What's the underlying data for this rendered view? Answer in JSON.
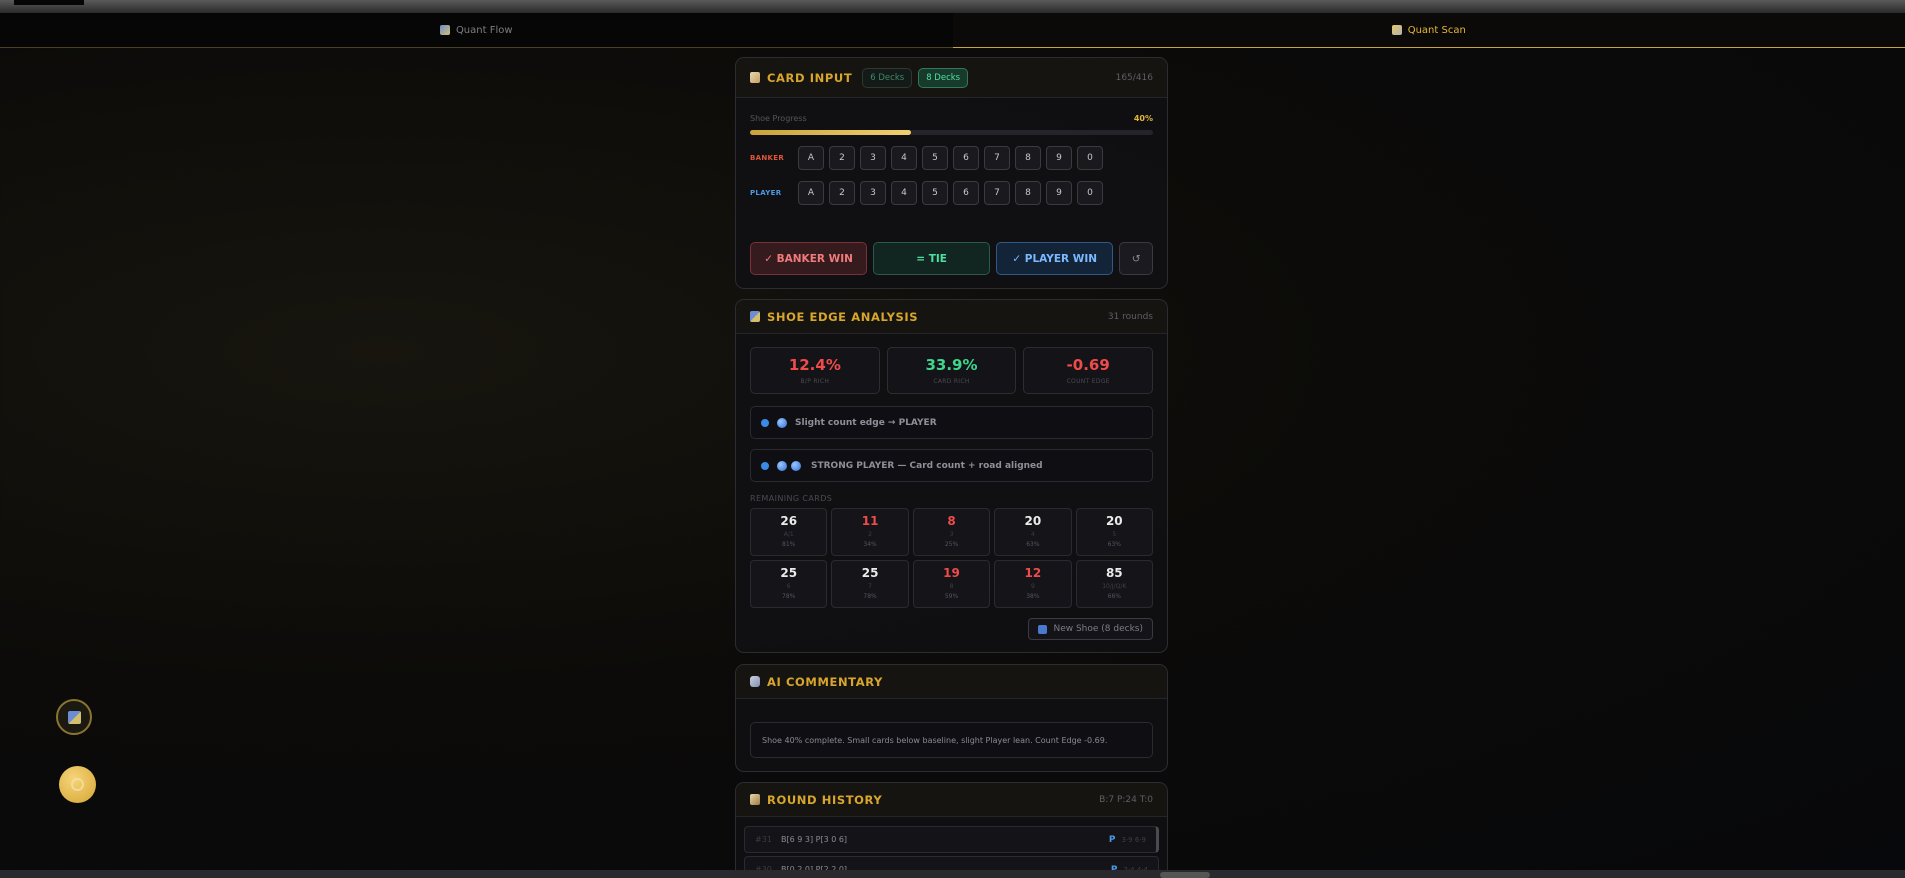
{
  "tabs": [
    {
      "label": "Quant Flow",
      "icon": "chart-icon"
    },
    {
      "label": "Quant Scan",
      "icon": "scan-icon"
    }
  ],
  "card_input": {
    "title": "CARD INPUT",
    "deck_options": [
      "6 Decks",
      "8 Decks"
    ],
    "selected_deck": "8 Decks",
    "counter": "165/416",
    "progress_label": "Shoe Progress",
    "progress_pct": "40%",
    "progress_value": 0.4,
    "banker_label": "BANKER",
    "player_label": "PLAYER",
    "keys": [
      "A",
      "2",
      "3",
      "4",
      "5",
      "6",
      "7",
      "8",
      "9",
      "0"
    ],
    "banker_win": "✓ BANKER WIN",
    "tie": "= TIE",
    "player_win": "✓ PLAYER WIN",
    "undo": "↺"
  },
  "edge": {
    "title": "SHOE EDGE ANALYSIS",
    "rounds": "31 rounds",
    "stats": [
      {
        "value": "12.4%",
        "label": "B/P RICH",
        "color": "#ef4b4b"
      },
      {
        "value": "33.9%",
        "label": "CARD RICH",
        "color": "#3dd68c"
      },
      {
        "value": "-0.69",
        "label": "COUNT EDGE",
        "color": "#ef4b4b"
      }
    ],
    "signal1": "Slight count edge → PLAYER",
    "signal2": "STRONG PLAYER — Card count + road aligned",
    "remaining_label": "REMAINING CARDS",
    "remaining": [
      {
        "n": "26",
        "r": "A/1",
        "pct": "81%",
        "low": false
      },
      {
        "n": "11",
        "r": "2",
        "pct": "34%",
        "low": true
      },
      {
        "n": "8",
        "r": "3",
        "pct": "25%",
        "low": true
      },
      {
        "n": "20",
        "r": "4",
        "pct": "63%",
        "low": false
      },
      {
        "n": "20",
        "r": "5",
        "pct": "63%",
        "low": false
      },
      {
        "n": "25",
        "r": "6",
        "pct": "78%",
        "low": false
      },
      {
        "n": "25",
        "r": "7",
        "pct": "78%",
        "low": false
      },
      {
        "n": "19",
        "r": "8",
        "pct": "59%",
        "low": true
      },
      {
        "n": "12",
        "r": "9",
        "pct": "38%",
        "low": true
      },
      {
        "n": "85",
        "r": "10/J/Q/K",
        "pct": "66%",
        "low": false
      }
    ],
    "new_shoe": "New Shoe (8 decks)"
  },
  "commentary": {
    "title": "AI COMMENTARY",
    "text": "Shoe 40% complete. Small cards below baseline, slight Player lean. Count Edge -0.69."
  },
  "history": {
    "title": "ROUND HISTORY",
    "summary": "B:7 P:24 T:0",
    "rows": [
      {
        "num": "#31",
        "cards": "B[6 9 3] P[3 0 6]",
        "result": "P",
        "meta": "3·9  6·9"
      },
      {
        "num": "#30",
        "cards": "B[0 2 0] P[2 2 0]",
        "result": "P",
        "meta": "2·4  4·4"
      }
    ]
  },
  "colors": {
    "accent": "#d9a62c",
    "banker": "#ef4b4b",
    "player": "#4a9ae6",
    "tie": "#3dd68c"
  }
}
